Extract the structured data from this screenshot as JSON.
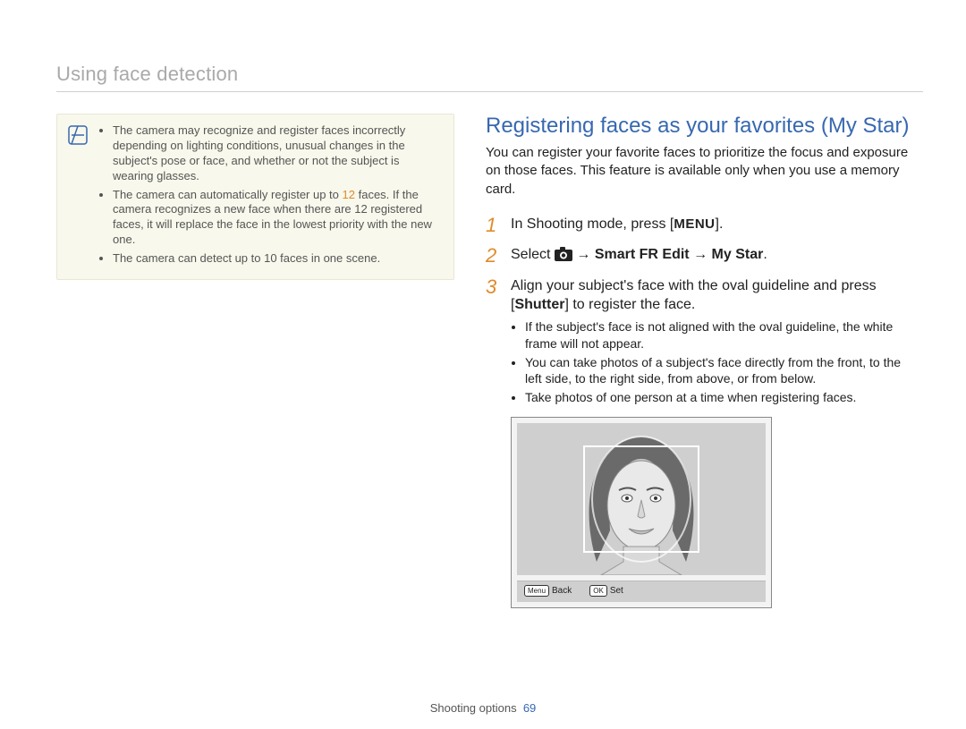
{
  "sectionTitle": "Using face detection",
  "noteBox": {
    "items": [
      {
        "pre": "The camera may recognize and register faces incorrectly depending on lighting conditions, unusual changes in the subject's pose or face, and whether or not the subject is wearing glasses."
      },
      {
        "pre": "The camera can automatically register up to ",
        "hl": "12",
        "post": " faces. If the camera recognizes a new face when there are 12 registered faces, it will replace the face in the lowest priority with the new one."
      },
      {
        "pre": "The camera can detect up to 10 faces in one scene."
      }
    ]
  },
  "right": {
    "title": "Registering faces as your favorites (My Star)",
    "intro": "You can register your favorite faces to prioritize the focus and exposure on those faces. This feature is available only when you use a memory card.",
    "step1": {
      "num": "1",
      "pre": "In Shooting mode, press [",
      "menu": "MENU",
      "post": "]."
    },
    "step2": {
      "num": "2",
      "pre": "Select ",
      "arrow1": " → ",
      "boldA": "Smart FR Edit",
      "arrow2": " → ",
      "boldB": "My Star",
      "post": "."
    },
    "step3": {
      "num": "3",
      "line1a": "Align your subject's face with the oval guideline and press [",
      "shutter": "Shutter",
      "line1b": "] to register the face.",
      "bullets": [
        "If the subject's face is not aligned with the oval guideline, the white frame will not appear.",
        "You can take photos of a subject's face directly from the front, to the left side, to the right side, from above, or from below.",
        "Take photos of one person at a time when registering faces."
      ]
    },
    "screenFooter": {
      "menuKey": "Menu",
      "backLabel": "Back",
      "okKey": "OK",
      "setLabel": "Set"
    }
  },
  "footer": {
    "label": "Shooting options",
    "page": "69"
  }
}
